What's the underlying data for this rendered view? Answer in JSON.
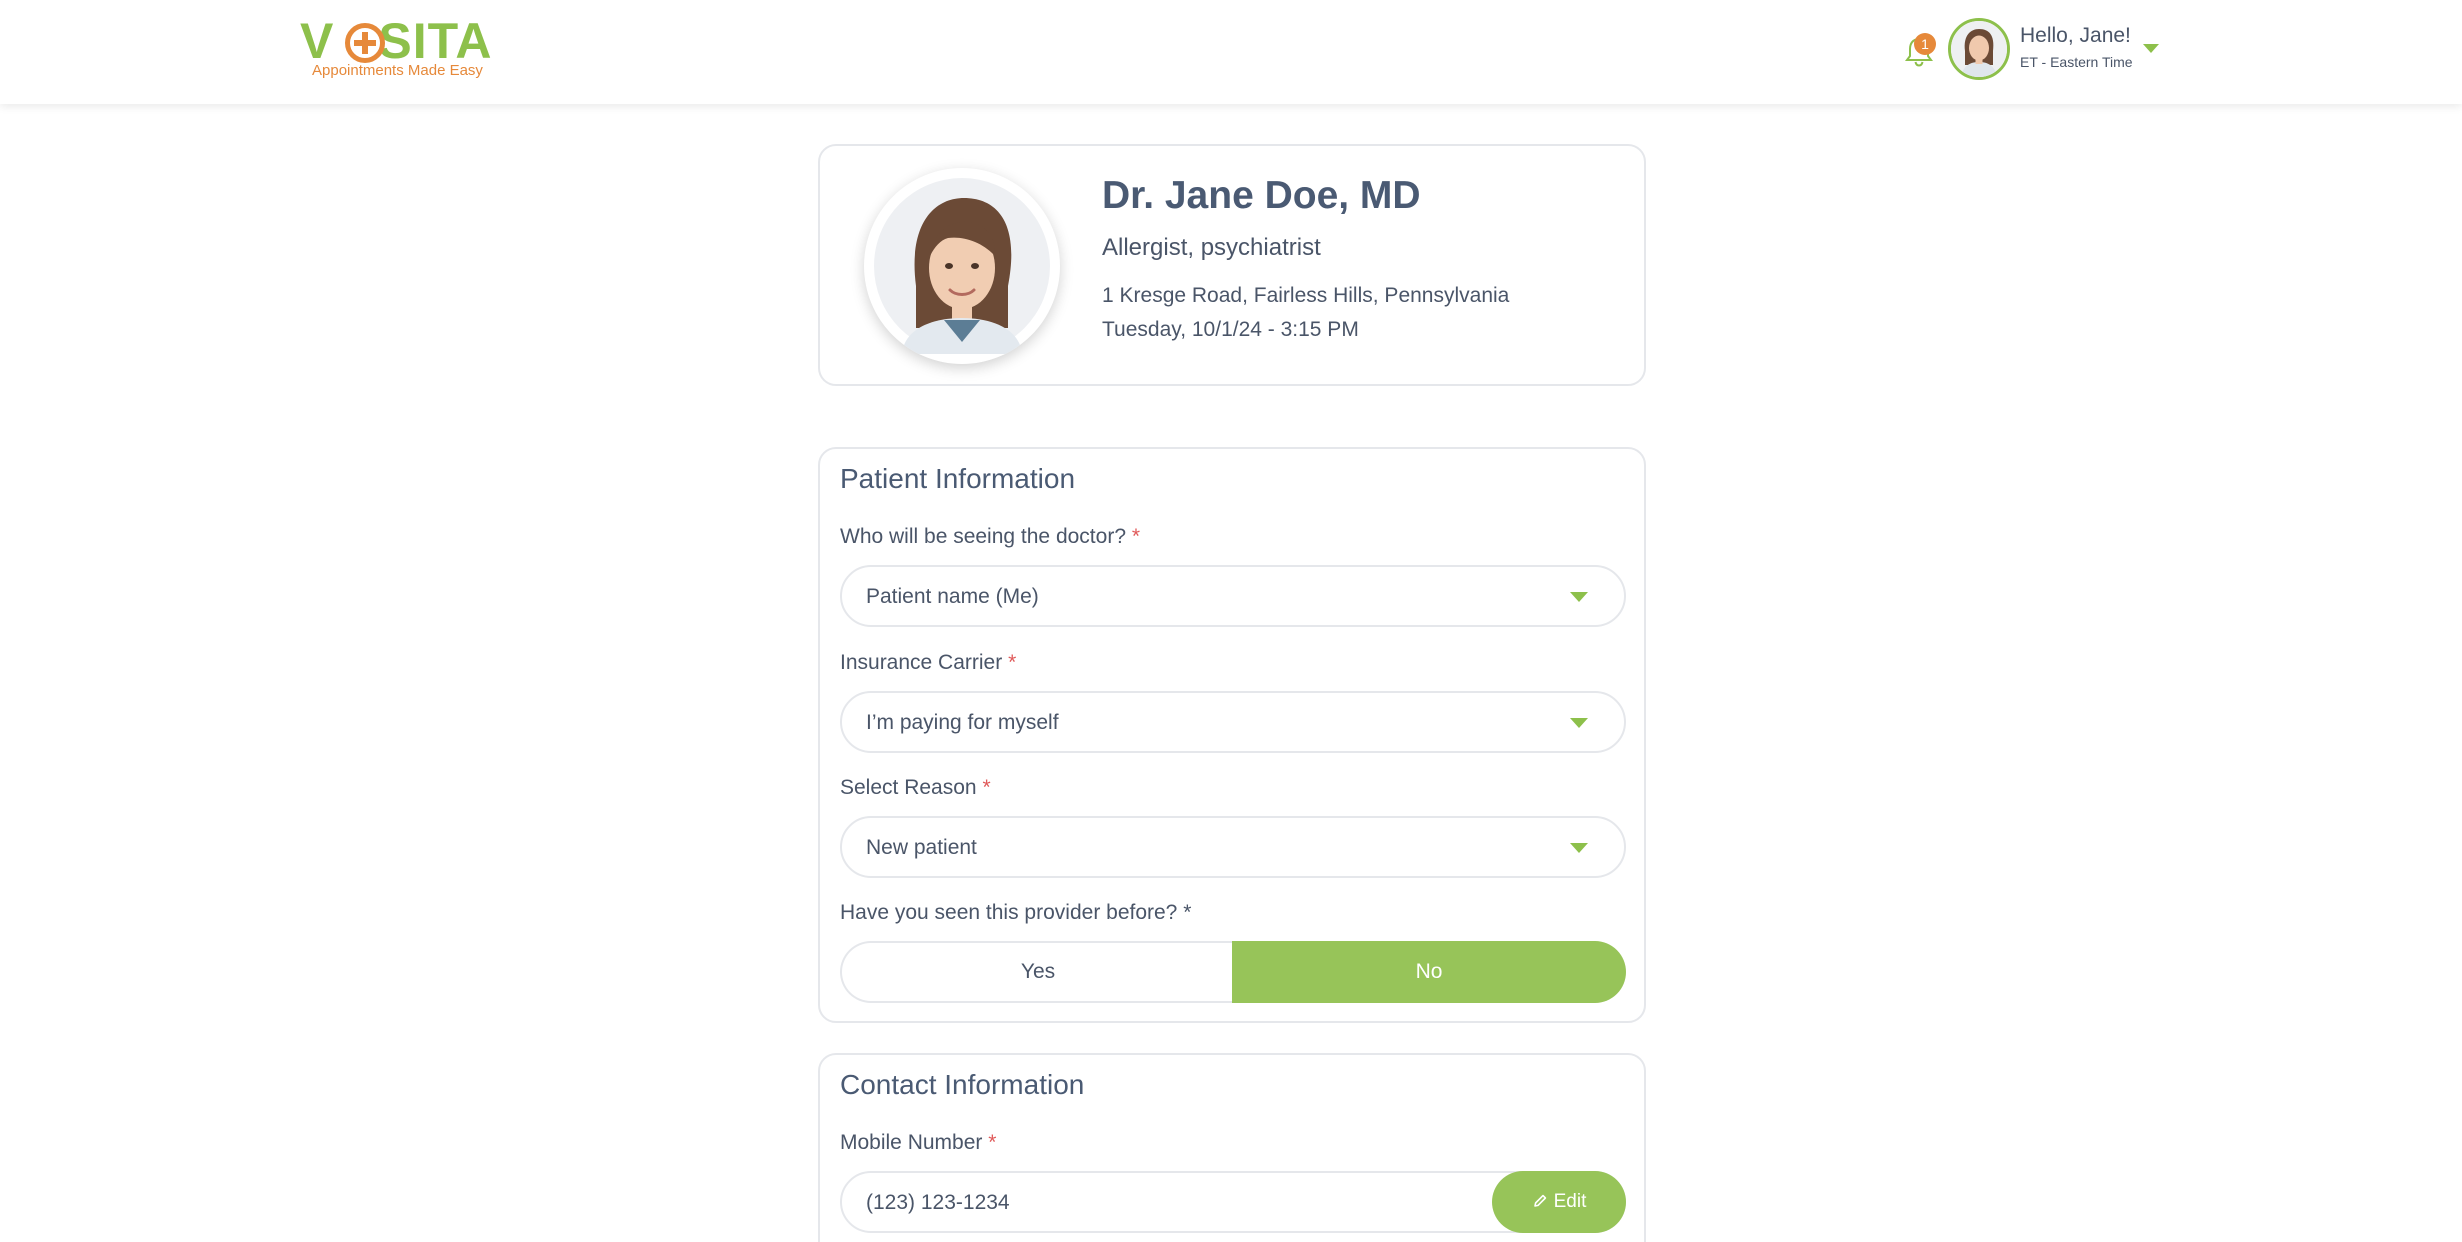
{
  "brand": {
    "logo_text_left": "V",
    "logo_text_right": "SITA",
    "tagline": "Appointments Made Easy",
    "green": "#8dc04b",
    "orange": "#e6893a"
  },
  "header": {
    "notification_count": "1",
    "greeting": "Hello, Jane!",
    "timezone": "ET - Eastern Time"
  },
  "doctor": {
    "name": "Dr. Jane Doe, MD",
    "specialty": "Allergist, psychiatrist",
    "address": "1 Kresge Road, Fairless Hills, Pennsylvania",
    "appointment": "Tuesday, 10/1/24 - 3:15 PM"
  },
  "patient_info": {
    "title": "Patient Information",
    "who_label": "Who will be seeing the doctor?",
    "who_value": "Patient name (Me)",
    "insurance_label": "Insurance Carrier",
    "insurance_value": "I’m paying for myself",
    "reason_label": "Select Reason",
    "reason_value": "New patient",
    "seen_label": "Have you seen this provider before? *",
    "seen_yes": "Yes",
    "seen_no": "No",
    "seen_selected": "No",
    "required_mark": "*"
  },
  "contact_info": {
    "title": "Contact Information",
    "mobile_label": "Mobile Number",
    "mobile_value": "(123) 123-1234",
    "edit_label": "Edit"
  },
  "icons": [
    "bell-icon",
    "caret-down-icon",
    "pencil-icon",
    "user-avatar",
    "doctor-photo"
  ]
}
